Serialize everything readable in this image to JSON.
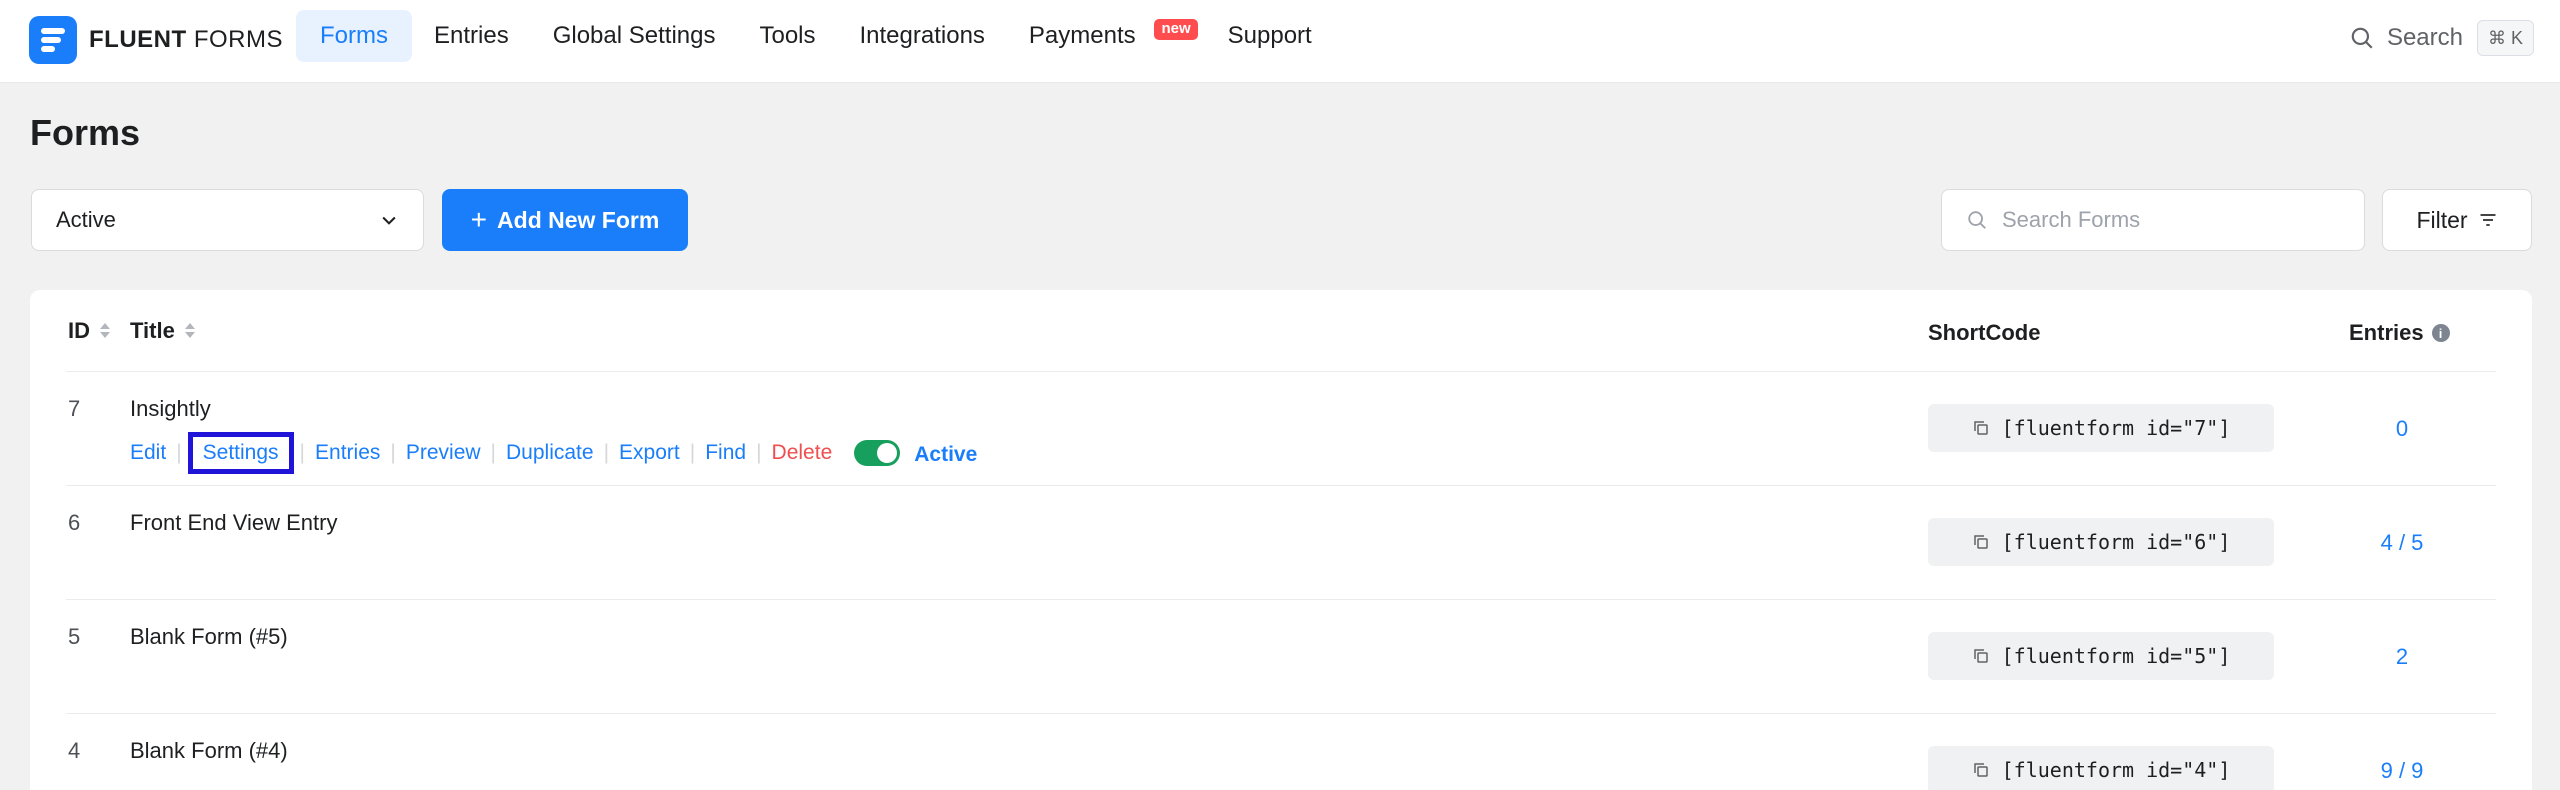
{
  "brand": {
    "name_bold": "FLUENT",
    "name_rest": " FORMS"
  },
  "nav": {
    "items": [
      {
        "label": "Forms",
        "active": true
      },
      {
        "label": "Entries"
      },
      {
        "label": "Global Settings"
      },
      {
        "label": "Tools"
      },
      {
        "label": "Integrations"
      },
      {
        "label": "Payments",
        "badge": "new"
      },
      {
        "label": "Support"
      }
    ]
  },
  "top_search": {
    "label": "Search",
    "shortcut": "⌘ K"
  },
  "page": {
    "title": "Forms"
  },
  "toolbar": {
    "status_value": "Active",
    "add_label": "Add New Form",
    "search_placeholder": "Search Forms",
    "filter_label": "Filter"
  },
  "table": {
    "headers": {
      "id": "ID",
      "title": "Title",
      "shortcode": "ShortCode",
      "entries": "Entries"
    },
    "row_actions": {
      "edit": "Edit",
      "settings": "Settings",
      "entries": "Entries",
      "preview": "Preview",
      "duplicate": "Duplicate",
      "export": "Export",
      "find": "Find",
      "delete": "Delete",
      "status": "Active"
    },
    "rows": [
      {
        "id": "7",
        "title": "Insightly",
        "shortcode": "[fluentform id=\"7\"]",
        "entries": "0"
      },
      {
        "id": "6",
        "title": "Front End View Entry",
        "shortcode": "[fluentform id=\"6\"]",
        "entries": "4 / 5"
      },
      {
        "id": "5",
        "title": "Blank Form (#5)",
        "shortcode": "[fluentform id=\"5\"]",
        "entries": "2"
      },
      {
        "id": "4",
        "title": "Blank Form (#4)",
        "shortcode": "[fluentform id=\"4\"]",
        "entries": "9 / 9"
      }
    ]
  },
  "colors": {
    "accent": "#1a7efb",
    "danger": "#ef4e4e",
    "toggle_on": "#17a05d",
    "highlight_box": "#1f14d8"
  }
}
